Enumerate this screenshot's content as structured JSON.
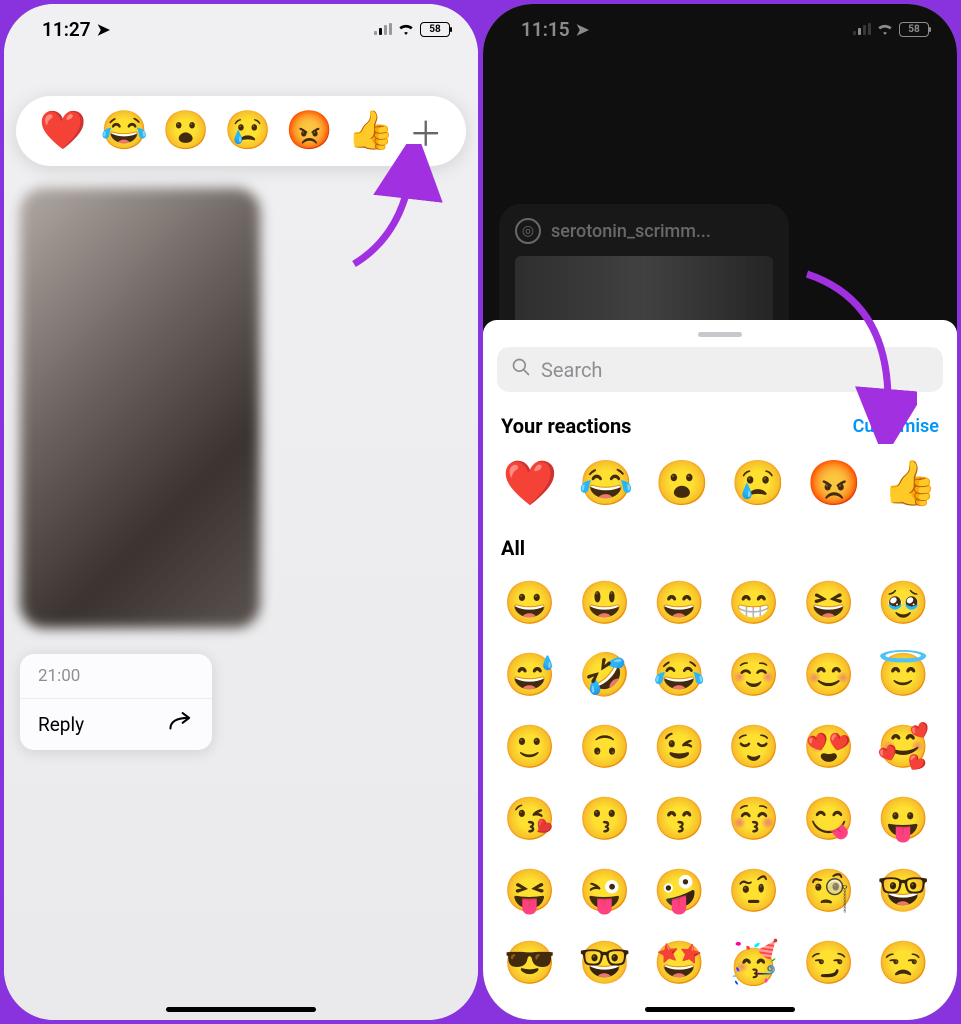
{
  "left": {
    "status": {
      "time": "11:27",
      "battery": "58"
    },
    "reactions": [
      "❤️",
      "😂",
      "😮",
      "😢",
      "😡",
      "👍"
    ],
    "context": {
      "time": "21:00",
      "reply": "Reply"
    }
  },
  "right": {
    "status": {
      "time": "11:15",
      "battery": "58"
    },
    "card_user": "serotonin_scrimm...",
    "sheet": {
      "search_placeholder": "Search",
      "your_reactions_label": "Your reactions",
      "customise_label": "Customise",
      "all_label": "All",
      "your_reactions": [
        "❤️",
        "😂",
        "😮",
        "😢",
        "😡",
        "👍"
      ],
      "all_emojis": [
        "😀",
        "😃",
        "😄",
        "😁",
        "😆",
        "🥹",
        "😅",
        "🤣",
        "😂",
        "☺️",
        "😊",
        "😇",
        "🙂",
        "🙃",
        "😉",
        "😌",
        "😍",
        "🥰",
        "😘",
        "😗",
        "😙",
        "😚",
        "😋",
        "😛",
        "😝",
        "😜",
        "🤪",
        "🤨",
        "🧐",
        "🤓",
        "😎",
        "🤓",
        "🤩",
        "🥳",
        "😏",
        "😒"
      ]
    }
  }
}
